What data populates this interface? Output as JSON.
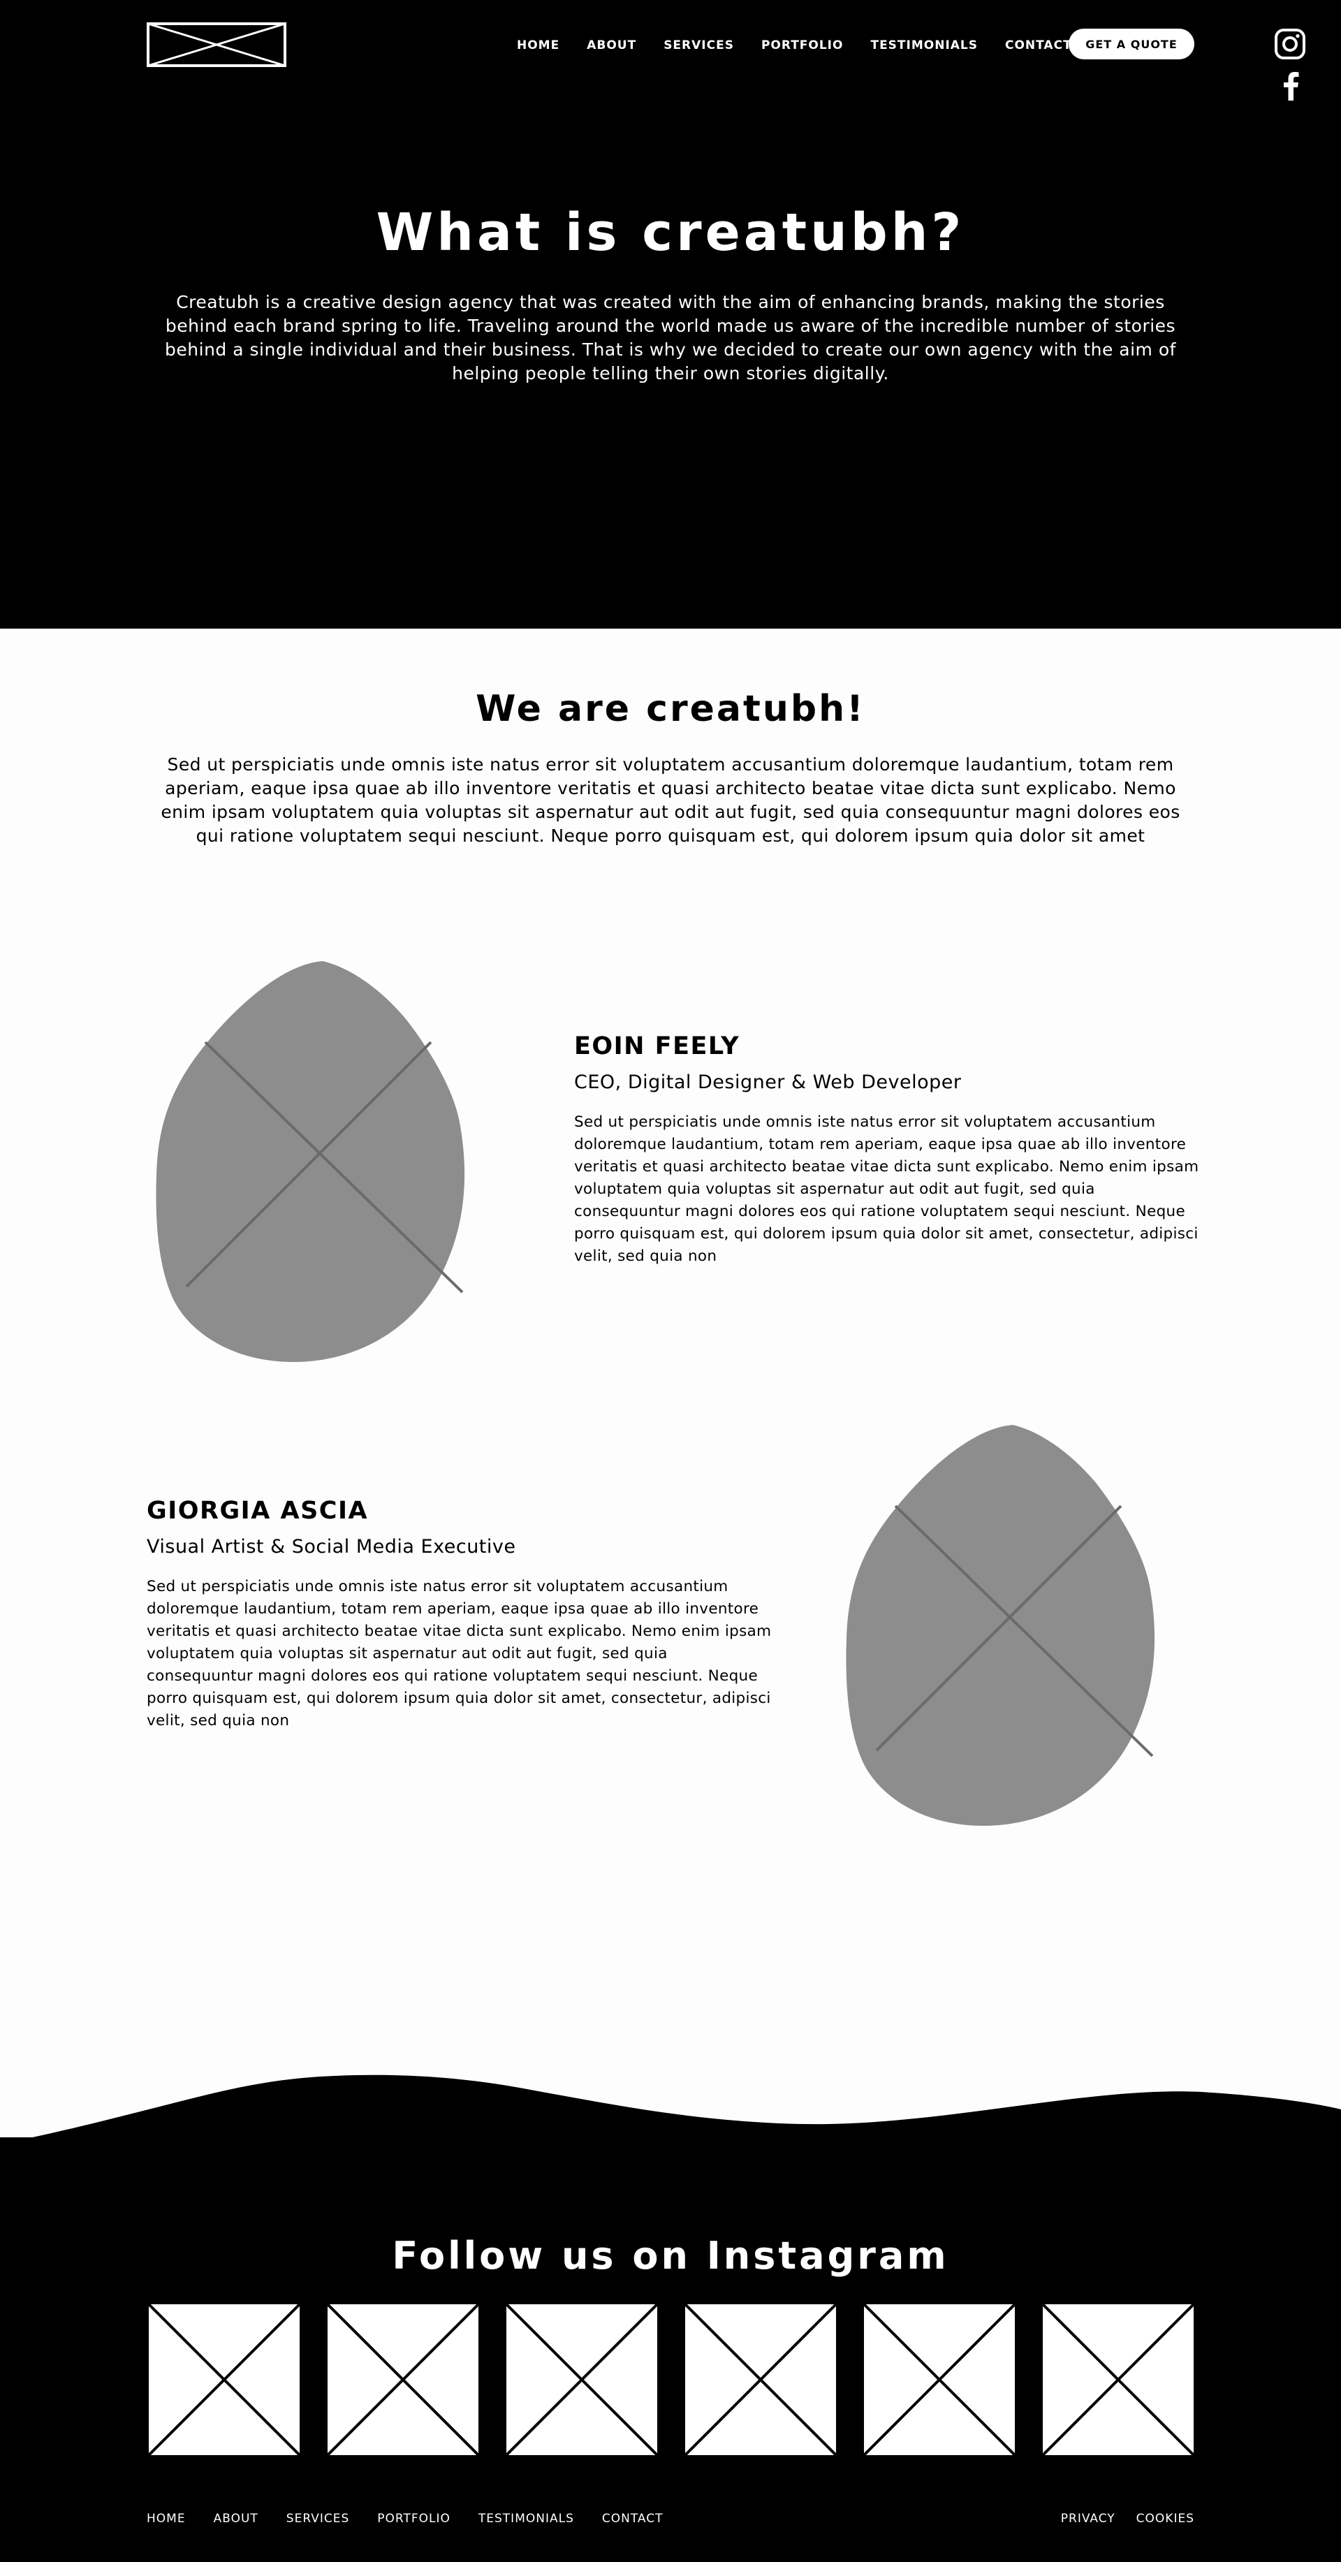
{
  "header": {
    "logo": "logo-placeholder-icon",
    "nav": [
      "HOME",
      "ABOUT",
      "SERVICES",
      "PORTFOLIO",
      "TESTIMONIALS",
      "CONTACT"
    ],
    "cta_label": "GET A QUOTE",
    "social": [
      "instagram-icon",
      "facebook-icon"
    ]
  },
  "hero": {
    "title": "What is creatubh?",
    "text": "Creatubh is a creative design agency that was created with the aim of enhancing brands, making the stories behind each brand spring to life. Traveling around the world made us aware of the incredible number of stories behind a single individual and their business. That is why we decided to create our own agency with the aim of helping people telling their own stories digitally."
  },
  "about": {
    "title": "We are creatubh!",
    "text": "Sed ut perspiciatis unde omnis iste natus error sit voluptatem accusantium doloremque laudantium, totam rem aperiam, eaque ipsa quae ab illo inventore veritatis et quasi architecto beatae vitae dicta sunt explicabo. Nemo enim ipsam voluptatem quia voluptas sit aspernatur aut odit aut fugit, sed quia consequuntur magni dolores eos qui ratione voluptatem sequi nesciunt. Neque porro quisquam est, qui dolorem ipsum quia dolor sit amet"
  },
  "team": [
    {
      "name": "EOIN FEELY",
      "role": "CEO, Digital Designer & Web Developer",
      "bio": "Sed ut perspiciatis unde omnis iste natus error sit voluptatem accusantium doloremque laudantium, totam rem aperiam, eaque ipsa quae ab illo inventore veritatis et quasi architecto beatae vitae dicta sunt explicabo. Nemo enim ipsam voluptatem quia voluptas sit aspernatur aut odit aut fugit, sed quia consequuntur magni dolores eos qui ratione voluptatem sequi nesciunt. Neque porro quisquam est, qui dolorem ipsum quia dolor sit amet, consectetur, adipisci velit, sed quia non"
    },
    {
      "name": "GIORGIA ASCIA",
      "role": "Visual Artist & Social Media Executive",
      "bio": "Sed ut perspiciatis unde omnis iste natus error sit voluptatem accusantium doloremque laudantium, totam rem aperiam, eaque ipsa quae ab illo inventore veritatis et quasi architecto beatae vitae dicta sunt explicabo. Nemo enim ipsam voluptatem quia voluptas sit aspernatur aut odit aut fugit, sed quia consequuntur magni dolores eos qui ratione voluptatem sequi nesciunt. Neque porro quisquam est, qui dolorem ipsum quia dolor sit amet, consectetur, adipisci velit, sed quia non"
    }
  ],
  "instagram": {
    "title": "Follow us on Instagram",
    "photos": [
      "image-placeholder-icon",
      "image-placeholder-icon",
      "image-placeholder-icon",
      "image-placeholder-icon",
      "image-placeholder-icon",
      "image-placeholder-icon"
    ]
  },
  "footer": {
    "nav": [
      "HOME",
      "ABOUT",
      "SERVICES",
      "PORTFOLIO",
      "TESTIMONIALS",
      "CONTACT"
    ],
    "legal": [
      "PRIVACY",
      "COOKIES"
    ]
  },
  "colors": {
    "background": "#000000",
    "light": "#fdfdfd",
    "blob_fill": "#8c8d8c",
    "blob_lines": "#6b6b6b"
  }
}
